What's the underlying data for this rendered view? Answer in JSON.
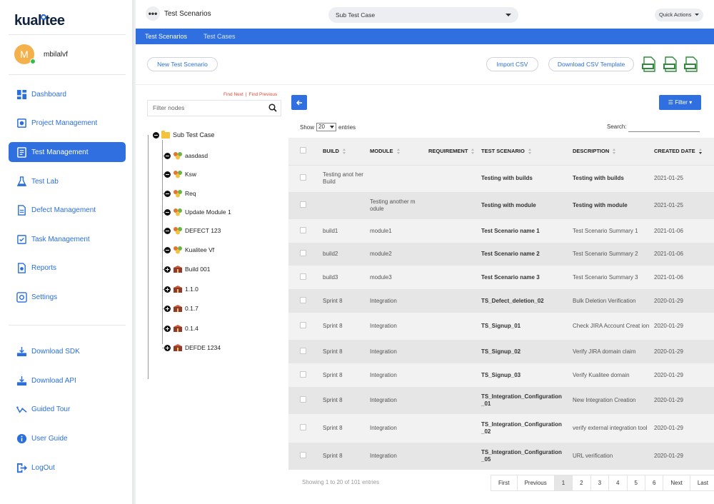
{
  "app": {
    "logo_text_a": "kual",
    "logo_text_b": "itee"
  },
  "user": {
    "initial": "M",
    "name": "mbilalvf"
  },
  "sidebar": {
    "items": [
      {
        "label": "Dashboard",
        "icon": "dashboard-icon"
      },
      {
        "label": "Project Management",
        "icon": "project-icon"
      },
      {
        "label": "Test Management",
        "icon": "test-management-icon",
        "active": true
      },
      {
        "label": "Test Lab",
        "icon": "flask-icon"
      },
      {
        "label": "Defect Management",
        "icon": "defect-icon"
      },
      {
        "label": "Task Management",
        "icon": "task-icon"
      },
      {
        "label": "Reports",
        "icon": "reports-icon"
      },
      {
        "label": "Settings",
        "icon": "gear-icon"
      }
    ],
    "bottom_items": [
      {
        "label": "Download SDK",
        "icon": "download-icon"
      },
      {
        "label": "Download API",
        "icon": "download-icon"
      },
      {
        "label": "Guided Tour",
        "icon": "tour-icon"
      },
      {
        "label": "User Guide",
        "icon": "info-icon"
      },
      {
        "label": "LogOut",
        "icon": "logout-icon"
      }
    ]
  },
  "header": {
    "title": "Test Scenarios",
    "context_select": "Sub Test Case",
    "quick_actions": "Quick Actions"
  },
  "tabs": [
    {
      "label": "Test Scenarios",
      "active": true
    },
    {
      "label": "Test Cases",
      "active": false
    }
  ],
  "toolbar": {
    "new_button": "New Test Scenario",
    "import_button": "Import CSV",
    "download_template_button": "Download CSV Template"
  },
  "tree": {
    "find_next": "Find Next",
    "find_previous": "Find Previous",
    "filter_placeholder": "Filter nodes",
    "root": "Sub Test Case",
    "nodes": [
      {
        "label": "aasdasd",
        "type": "module",
        "expanded": true
      },
      {
        "label": "Ksw",
        "type": "module",
        "expanded": true
      },
      {
        "label": "Req",
        "type": "module",
        "expanded": true
      },
      {
        "label": "Update Module 1",
        "type": "module",
        "expanded": true
      },
      {
        "label": "DEFECT 123",
        "type": "module",
        "expanded": true
      },
      {
        "label": "Kualitee Vf",
        "type": "module",
        "expanded": true
      },
      {
        "label": "Build 001",
        "type": "build",
        "expanded": false
      },
      {
        "label": "1.1.0",
        "type": "build",
        "expanded": false
      },
      {
        "label": "0.1.7",
        "type": "build",
        "expanded": false
      },
      {
        "label": "0.1.4",
        "type": "build",
        "expanded": false
      },
      {
        "label": "DEFDE 1234",
        "type": "build",
        "expanded": false
      }
    ]
  },
  "table_controls": {
    "filter_button": "Filter",
    "show_label": "Show",
    "entries_value": "20",
    "entries_label": "entries",
    "search_label": "Search:"
  },
  "table": {
    "columns": [
      "BUILD",
      "MODULE",
      "REQUIREMENT",
      "TEST SCENARIO",
      "DESCRIPTION",
      "CREATED DATE"
    ],
    "rows": [
      {
        "build": "Testing anot her Build",
        "module": "",
        "requirement": "",
        "scenario": "Testing with builds",
        "description": "Testing with builds",
        "date": "2021-01-25",
        "desc_bold": true
      },
      {
        "build": "",
        "module": "Testing another m odule",
        "requirement": "",
        "scenario": "Testing with module",
        "description": "Testing with module",
        "date": "2021-01-25",
        "desc_bold": true
      },
      {
        "build": "build1",
        "module": "module1",
        "requirement": "",
        "scenario": "Test Scenario name 1",
        "description": "Test Scenario Summary 1",
        "date": "2021-01-06"
      },
      {
        "build": "build2",
        "module": "module2",
        "requirement": "",
        "scenario": "Test Scenario name 2",
        "description": "Test Scenario Summary 2",
        "date": "2021-01-06"
      },
      {
        "build": "build3",
        "module": "module3",
        "requirement": "",
        "scenario": "Test Scenario name 3",
        "description": "Test Scenario Summary 3",
        "date": "2021-01-06"
      },
      {
        "build": "Sprint 8",
        "module": "Integration",
        "requirement": "",
        "scenario": "TS_Defect_deletion_02",
        "description": "Bulk Deletion Verification",
        "date": "2020-01-29"
      },
      {
        "build": "Sprint 8",
        "module": "Integration",
        "requirement": "",
        "scenario": "TS_Signup_01",
        "description": "Check JIRA Account Creat ion",
        "date": "2020-01-29"
      },
      {
        "build": "Sprint 8",
        "module": "Integration",
        "requirement": "",
        "scenario": "TS_Signup_02",
        "description": "Verify JIRA domain claim",
        "date": "2020-01-29"
      },
      {
        "build": "Sprint 8",
        "module": "Integration",
        "requirement": "",
        "scenario": "TS_Signup_03",
        "description": "Verify Kualitee domain",
        "date": "2020-01-29"
      },
      {
        "build": "Sprint 8",
        "module": "Integration",
        "requirement": "",
        "scenario": "TS_Integration_Configuration _01",
        "description": "New Integration Creation",
        "date": "2020-01-29"
      },
      {
        "build": "Sprint 8",
        "module": "Integration",
        "requirement": "",
        "scenario": "TS_Integration_Configuration _02",
        "description": "verify external integration tool",
        "date": "2020-01-29"
      },
      {
        "build": "Sprint 8",
        "module": "Integration",
        "requirement": "",
        "scenario": "TS_Integration_Configuration _05",
        "description": "URL verification",
        "date": "2020-01-29"
      }
    ]
  },
  "footer": {
    "info": "Showing 1 to 20 of 101 entries",
    "pages": [
      "First",
      "Previous",
      "1",
      "2",
      "3",
      "4",
      "5",
      "6",
      "Next",
      "Last"
    ],
    "active_page": "1"
  },
  "colors": {
    "accent": "#2f6fe0",
    "link": "#2a6fdb",
    "find_links": "#e04a3a",
    "csv_green": "#2e8b3a"
  }
}
